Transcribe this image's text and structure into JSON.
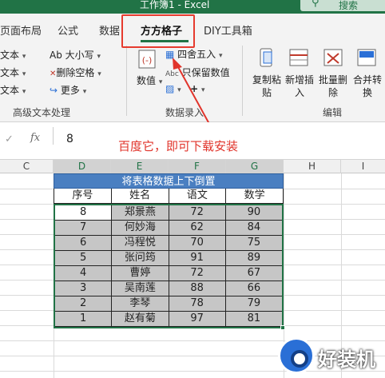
{
  "titlebar": {
    "title": "工作簿1 - Excel",
    "search_label": "搜索"
  },
  "tabs": [
    "页面布局",
    "公式",
    "数据",
    "方方格子",
    "DIY工具箱"
  ],
  "ribbon": {
    "text_group": {
      "items": [
        "文本",
        "文本",
        "文本",
        "Ab 大小写",
        "删除空格",
        "更多"
      ],
      "label": "高级文本处理"
    },
    "data_entry": {
      "items": [
        "数值",
        "四舍五入",
        "只保留数值"
      ],
      "label": "数据录入"
    },
    "edit_group": {
      "items": [
        "复制粘贴",
        "新增插入",
        "批量删除",
        "合并转换"
      ],
      "label": "编辑"
    }
  },
  "formula_bar": {
    "fx": "fx",
    "value": "8",
    "annotation": "百度它，即可下载安装"
  },
  "columns": [
    "C",
    "D",
    "E",
    "F",
    "G",
    "H",
    "I"
  ],
  "table": {
    "title": "将表格数据上下倒置",
    "headers": [
      "序号",
      "姓名",
      "语文",
      "数学"
    ],
    "rows": [
      [
        "8",
        "郑景燕",
        "72",
        "90"
      ],
      [
        "7",
        "何妙海",
        "62",
        "84"
      ],
      [
        "6",
        "冯程悦",
        "70",
        "75"
      ],
      [
        "5",
        "张问筠",
        "91",
        "89"
      ],
      [
        "4",
        "曹婷",
        "72",
        "67"
      ],
      [
        "3",
        "吴南莲",
        "88",
        "66"
      ],
      [
        "2",
        "李琴",
        "78",
        "79"
      ],
      [
        "1",
        "赵有菊",
        "97",
        "81"
      ]
    ]
  },
  "watermark": {
    "text": "好装机"
  }
}
